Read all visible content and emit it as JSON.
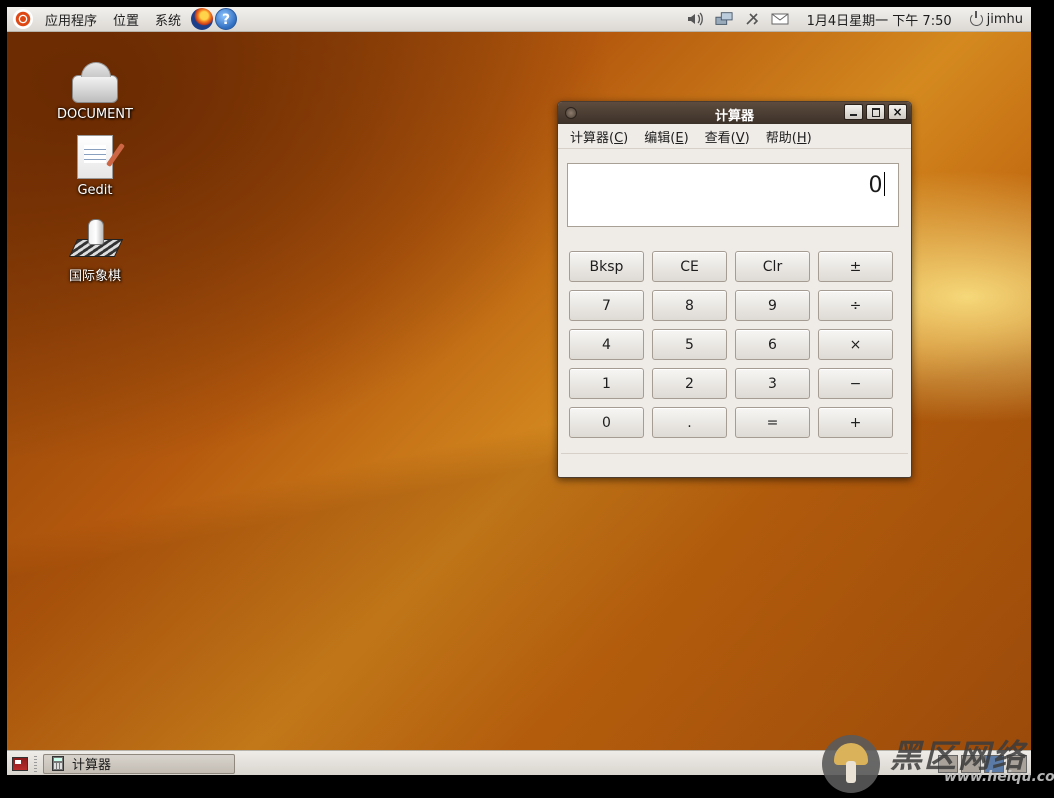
{
  "top_panel": {
    "menus": [
      "应用程序",
      "位置",
      "系统"
    ],
    "clock": "1月4日星期一 下午 7:50",
    "user": "jimhu",
    "launchers": [
      "firefox-icon",
      "help-icon"
    ],
    "help_glyph": "?",
    "tray_icons": [
      "volume-icon",
      "network-icon",
      "bluetooth-icon",
      "mail-icon"
    ]
  },
  "desktop": {
    "icons": [
      {
        "label": "DOCUMENT",
        "icon": "drive-icon"
      },
      {
        "label": "Gedit",
        "icon": "text-editor-icon"
      },
      {
        "label": "国际象棋",
        "icon": "chess-icon"
      }
    ]
  },
  "calculator": {
    "title": "计算器",
    "menu": [
      {
        "label": "计算器",
        "mnemonic": "C"
      },
      {
        "label": "编辑",
        "mnemonic": "E"
      },
      {
        "label": "查看",
        "mnemonic": "V"
      },
      {
        "label": "帮助",
        "mnemonic": "H"
      }
    ],
    "close_glyph": "×",
    "display_value": "0",
    "keys": [
      [
        "Bksp",
        "CE",
        "Clr",
        "±"
      ],
      [
        "7",
        "8",
        "9",
        "÷"
      ],
      [
        "4",
        "5",
        "6",
        "×"
      ],
      [
        "1",
        "2",
        "3",
        "−"
      ],
      [
        "0",
        ".",
        "=",
        "+"
      ]
    ]
  },
  "bottom_panel": {
    "task_label": "计算器"
  },
  "watermark": {
    "text": "黑区网络",
    "url": "www.heiqu.com"
  }
}
